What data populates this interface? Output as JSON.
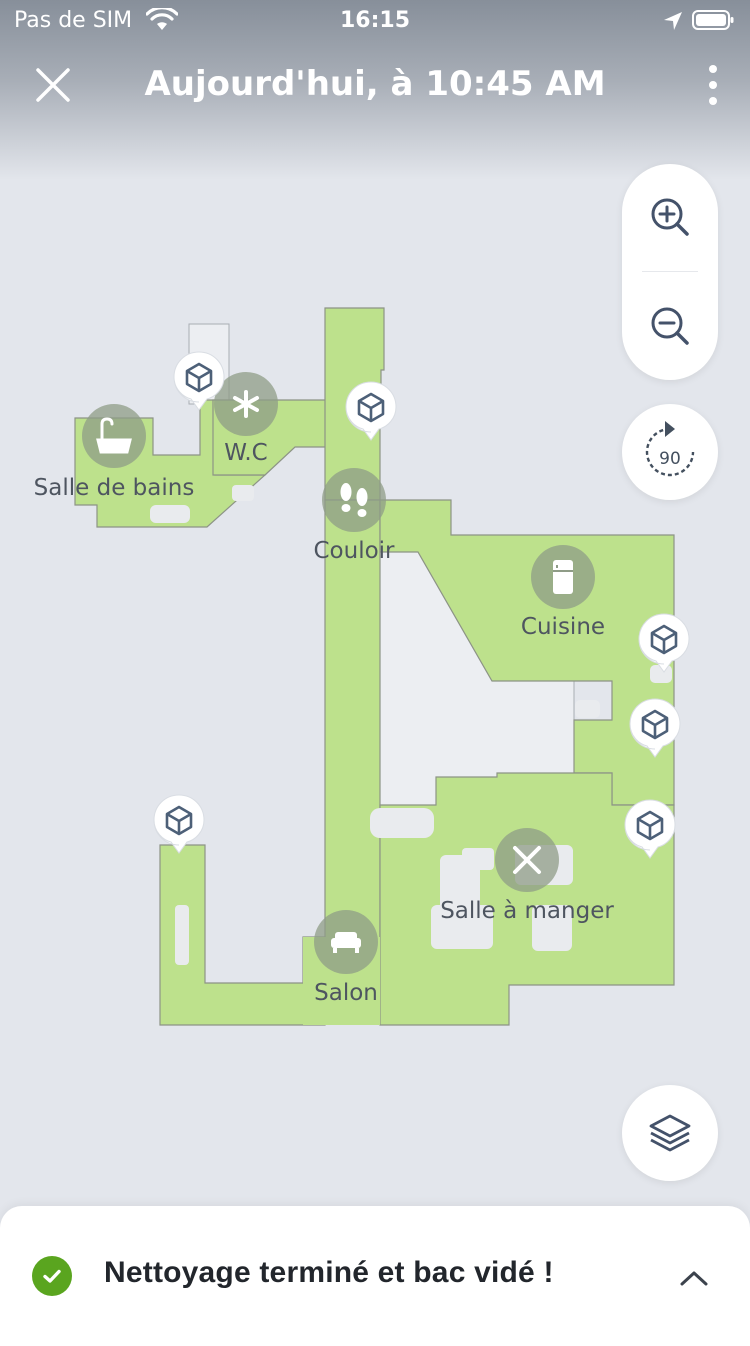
{
  "status_bar": {
    "carrier": "Pas de SIM",
    "time": "16:15"
  },
  "header": {
    "title": "Aujourd'hui, à 10:45 AM"
  },
  "map": {
    "rooms": [
      {
        "label": "Salle de bains",
        "icon": "bathtub-icon"
      },
      {
        "label": "W.C",
        "icon": "asterisk-icon"
      },
      {
        "label": "Couloir",
        "icon": "footprints-icon"
      },
      {
        "label": "Cuisine",
        "icon": "fridge-icon"
      },
      {
        "label": "Salle à manger",
        "icon": "utensils-icon"
      },
      {
        "label": "Salon",
        "icon": "armchair-icon"
      }
    ],
    "markers_icon": "cube-icon",
    "floor_color": "#bde18c",
    "void_color": "#eceef2"
  },
  "controls": {
    "zoom_in_icon": "zoom-in-icon",
    "zoom_out_icon": "zoom-out-icon",
    "rotate_label": "90",
    "layers_icon": "layers-icon"
  },
  "bottom_sheet": {
    "message": "Nettoyage terminé et bac vidé !",
    "status_color": "#5aa51f"
  }
}
